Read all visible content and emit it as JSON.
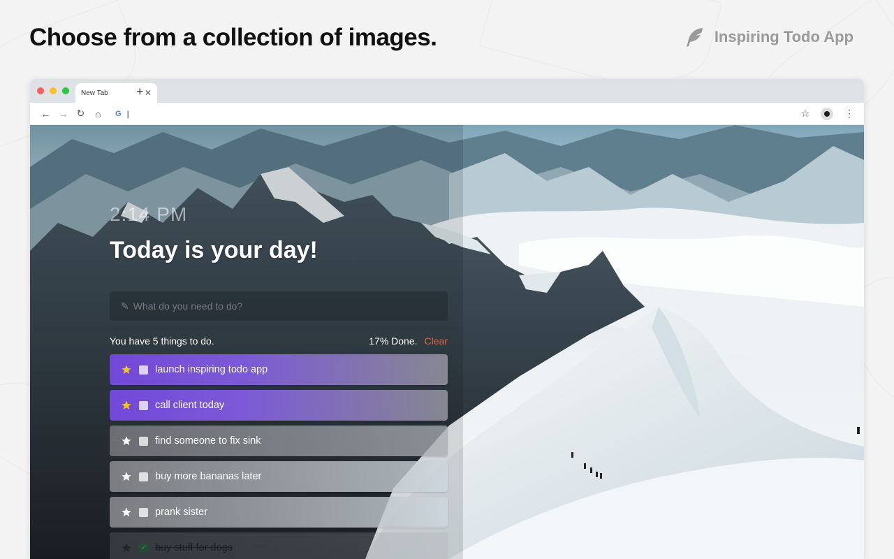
{
  "promo": {
    "headline": "Choose from a collection of images.",
    "brand_name": "Inspiring Todo App",
    "brand_icon": "feather-icon"
  },
  "browser": {
    "tab_title": "New Tab",
    "tab_close": "✕",
    "new_tab": "+",
    "address_value": "|",
    "traffic_colors": [
      "#ff5f57",
      "#febc2e",
      "#28c840"
    ]
  },
  "app": {
    "clock": "2:14 PM",
    "greeting": "Today is your day!",
    "new_todo_placeholder": "What do you need to do?",
    "status_left": "You have 5 things to do.",
    "status_done": "17% Done.",
    "clear_label": "Clear",
    "todos": [
      {
        "text": "launch inspiring todo app",
        "starred": true,
        "done": false
      },
      {
        "text": "call client today",
        "starred": true,
        "done": false
      },
      {
        "text": "find someone to fix sink",
        "starred": false,
        "done": false
      },
      {
        "text": "buy more bananas later",
        "starred": false,
        "done": false
      },
      {
        "text": "prank sister",
        "starred": false,
        "done": false
      },
      {
        "text": "buy stuff for dogs",
        "starred": false,
        "done": true
      }
    ],
    "colors": {
      "star_active": "#f5c518",
      "star_inactive": "#ffffff",
      "starred_row": "#7248d9",
      "clear": "#d9643f"
    }
  }
}
